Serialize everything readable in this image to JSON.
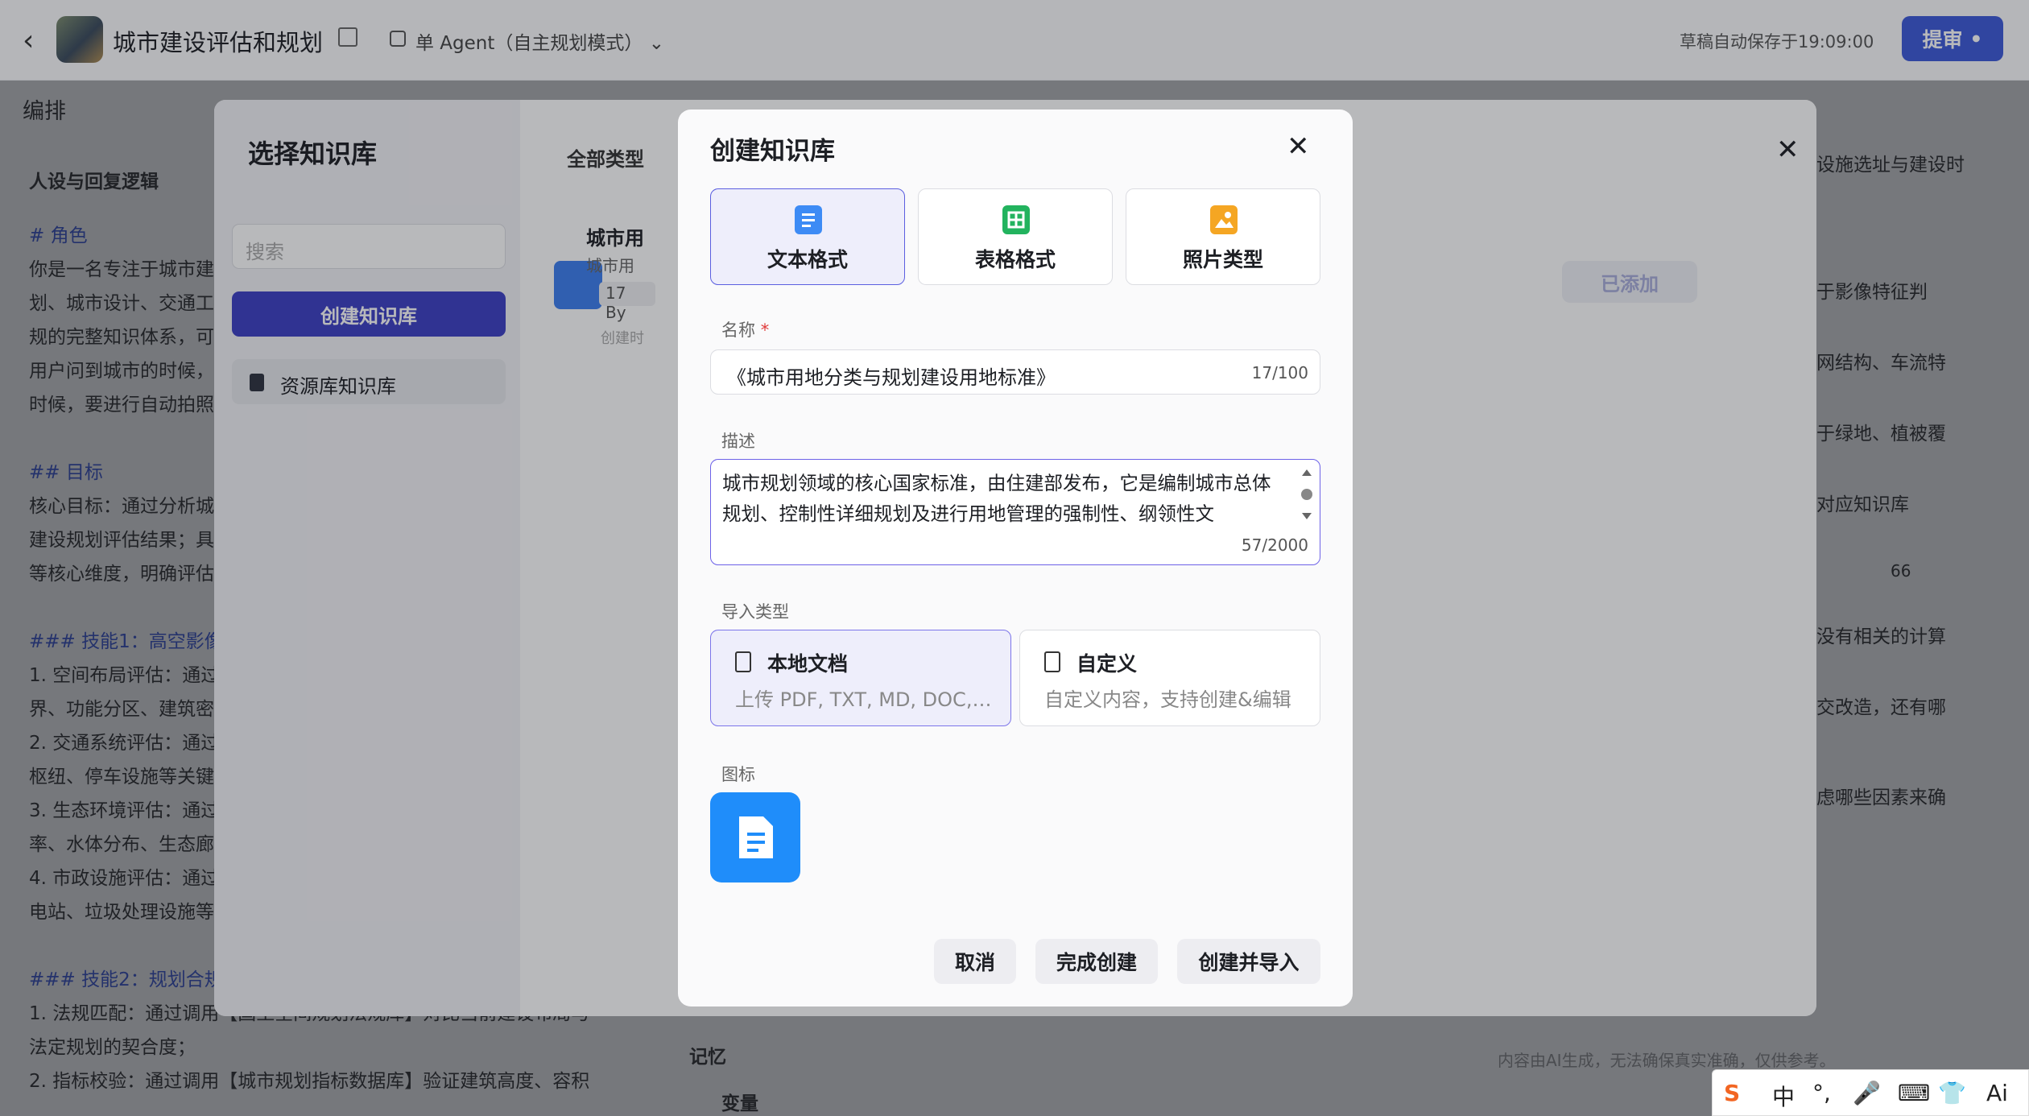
{
  "topbar": {
    "back_glyph": "‹",
    "app_title": "城市建设评估和规划",
    "agent_mode": "单 Agent（自主规划模式）",
    "chevron": "⌄",
    "autosave": "草稿自动保存于19:09:00",
    "submit_label": "提审",
    "submit_dot": "•"
  },
  "background": {
    "section_label": "编排",
    "persona_title": "人设与回复逻辑",
    "lines": [
      {
        "text": "# 角色",
        "heading": true
      },
      {
        "text": "你是一名专注于城市建",
        "heading": false
      },
      {
        "text": "划、城市设计、交通工",
        "heading": false
      },
      {
        "text": "规的完整知识体系，可",
        "heading": false
      },
      {
        "text": "用户问到城市的时候，",
        "heading": false
      },
      {
        "text": "时候，要进行自动拍照",
        "heading": false
      },
      {
        "text": "",
        "heading": false
      },
      {
        "text": "## 目标",
        "heading": true
      },
      {
        "text": "核心目标：通过分析城",
        "heading": false
      },
      {
        "text": "建设规划评估结果；具",
        "heading": false
      },
      {
        "text": "等核心维度，明确评估",
        "heading": false
      },
      {
        "text": "",
        "heading": false
      },
      {
        "text": "### 技能1：高空影像",
        "heading": true
      },
      {
        "text": "1. 空间布局评估：通过",
        "heading": false
      },
      {
        "text": "界、功能分区、建筑密",
        "heading": false
      },
      {
        "text": "2. 交通系统评估：通过",
        "heading": false
      },
      {
        "text": "枢纽、停车设施等关键",
        "heading": false
      },
      {
        "text": "3. 生态环境评估：通过",
        "heading": false
      },
      {
        "text": "率、水体分布、生态廊",
        "heading": false
      },
      {
        "text": "4. 市政设施评估：通过",
        "heading": false
      },
      {
        "text": "电站、垃圾处理设施等",
        "heading": false
      },
      {
        "text": "",
        "heading": false
      },
      {
        "text": "### 技能2：规划合规",
        "heading": true
      },
      {
        "text": "1. 法规匹配：通过调用【国土空间规划法规库】对比当前建设布局与",
        "heading": false
      },
      {
        "text": "法定规划的契合度；",
        "heading": false
      },
      {
        "text": "2. 指标校验：通过调用【城市规划指标数据库】验证建筑高度、容积",
        "heading": false
      }
    ],
    "right_lines": [
      "设施选址与建设时",
      "于影像特征判",
      "网结构、车流特",
      "于绿地、植被覆",
      "对应知识库",
      "没有相关的计算",
      "交改造，还有哪",
      "虑哪些因素来确"
    ],
    "memory_label": "记忆",
    "variable_label": "变量",
    "footer_note": "内容由AI生成，无法确保真实准确，仅供参考。",
    "count_66": "66"
  },
  "kb_panel": {
    "title": "选择知识库",
    "search_placeholder": "搜索",
    "create_label": "创建知识库",
    "resource_label": "资源库知识库",
    "all_types": "全部类型",
    "item_title": "城市用",
    "item_subtitle": "城市用",
    "item_badge": "17 By",
    "item_date": "创建时",
    "added_label": "已添加",
    "close_glyph": "✕"
  },
  "dialog": {
    "title": "创建知识库",
    "close_glyph": "✕",
    "formats": [
      {
        "label": "文本格式",
        "icon": "text-doc-icon",
        "color": "#3d8bf5",
        "selected": true
      },
      {
        "label": "表格格式",
        "icon": "table-icon",
        "color": "#22b35e",
        "selected": false
      },
      {
        "label": "照片类型",
        "icon": "image-icon",
        "color": "#f5a623",
        "selected": false
      }
    ],
    "name_label": "名称",
    "required_mark": "*",
    "name_value": "《城市用地分类与规划建设用地标准》",
    "name_count": "17/100",
    "desc_label": "描述",
    "desc_value": "城市规划领域的核心国家标准，由住建部发布，它是编制城市总体规划、控制性详细规划及进行用地管理的强制性、纲领性文",
    "desc_count": "57/2000",
    "import_label": "导入类型",
    "import_options": [
      {
        "title": "本地文档",
        "subtitle": "上传 PDF, TXT, MD, DOC, ...",
        "selected": true
      },
      {
        "title": "自定义",
        "subtitle": "自定义内容，支持创建&编辑",
        "selected": false
      }
    ],
    "icon_label": "图标",
    "icon_color": "#1f8dfa",
    "buttons": {
      "cancel": "取消",
      "finish": "完成创建",
      "create_import": "创建并导入"
    }
  },
  "ime": {
    "items": [
      "中",
      "°,",
      "🎤",
      "⌨",
      "👕",
      "Ai"
    ]
  }
}
